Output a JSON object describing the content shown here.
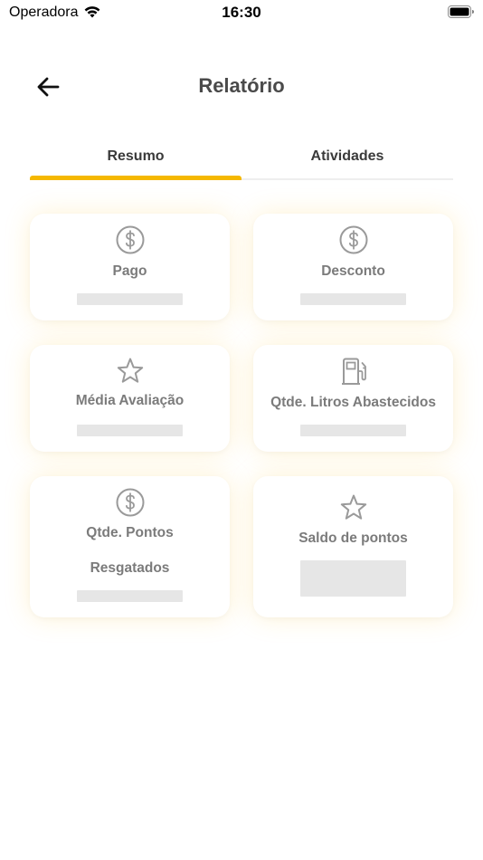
{
  "status_bar": {
    "carrier": "Operadora",
    "time": "16:30"
  },
  "header": {
    "title": "Relatório"
  },
  "tabs": [
    {
      "label": "Resumo",
      "active": true
    },
    {
      "label": "Atividades",
      "active": false
    }
  ],
  "colors": {
    "accent": "#f5b800",
    "label": "#7b7b7b",
    "placeholder": "#e6e6e6"
  },
  "cards": [
    {
      "label": "Pago",
      "icon": "dollar-circle-icon"
    },
    {
      "label": "Desconto",
      "icon": "dollar-circle-icon"
    },
    {
      "label": "Média Avaliação",
      "icon": "star-icon"
    },
    {
      "label": "Qtde. Litros Abastecidos",
      "icon": "fuel-pump-icon"
    },
    {
      "label_line1": "Qtde. Pontos",
      "label_line2": "Resgatados",
      "icon": "dollar-circle-icon"
    },
    {
      "label": "Saldo de pontos",
      "icon": "star-icon"
    }
  ]
}
